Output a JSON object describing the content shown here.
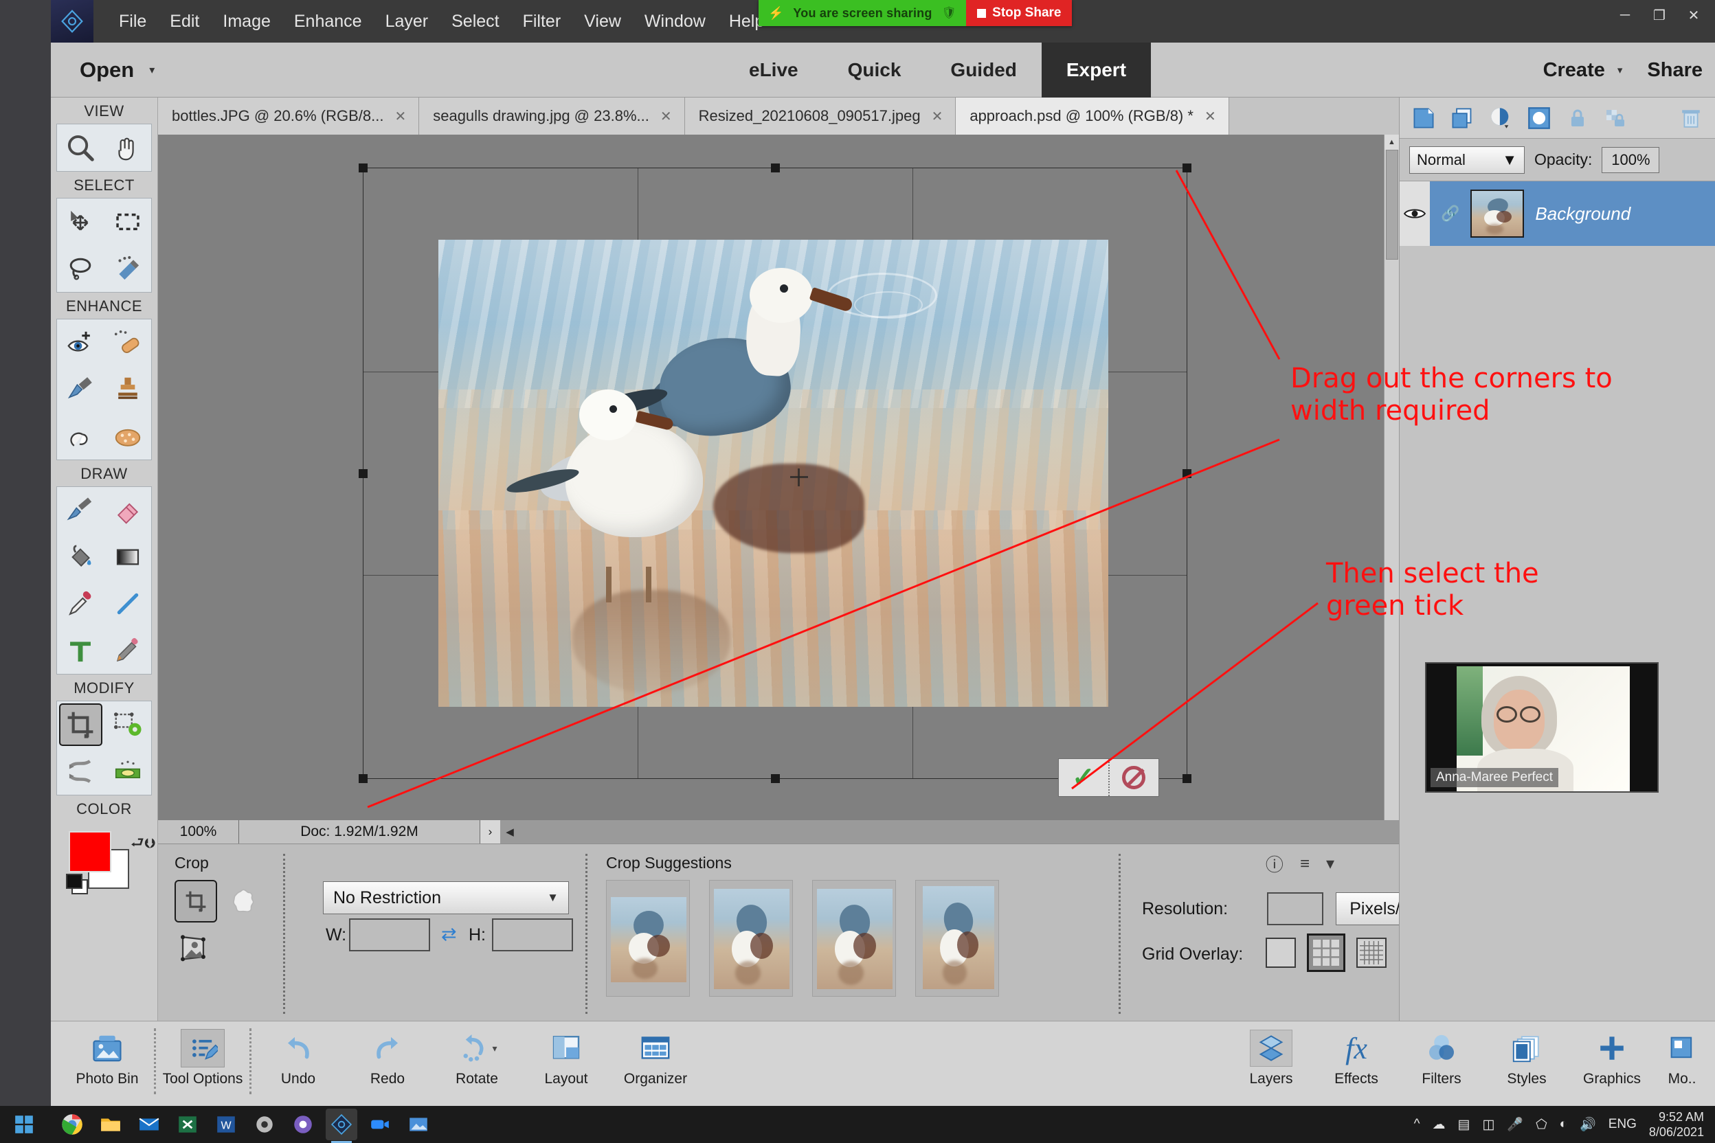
{
  "window": {
    "minimize": "─",
    "restore": "❐",
    "close": "✕"
  },
  "menubar": {
    "logo_icon": "photoshop-elements-logo-icon",
    "items": [
      "File",
      "Edit",
      "Image",
      "Enhance",
      "Layer",
      "Select",
      "Filter",
      "View",
      "Window",
      "Help"
    ]
  },
  "share_banner": {
    "lightning_icon": "lightning-icon",
    "message": "You are screen sharing",
    "shield_icon": "shield-icon",
    "stop_label": "Stop Share"
  },
  "modebar": {
    "open_label": "Open",
    "open_caret": "▾",
    "modes": [
      {
        "label": "eLive",
        "active": false
      },
      {
        "label": "Quick",
        "active": false
      },
      {
        "label": "Guided",
        "active": false
      },
      {
        "label": "Expert",
        "active": true
      }
    ],
    "create_label": "Create",
    "create_caret": "▾",
    "share_label": "Share"
  },
  "toolbar": {
    "groups": [
      {
        "title": "VIEW",
        "tools": [
          "zoom-tool",
          "hand-tool"
        ]
      },
      {
        "title": "SELECT",
        "tools": [
          "move-tool",
          "rectangular-marquee-tool",
          "lasso-tool",
          "quick-selection-tool"
        ]
      },
      {
        "title": "ENHANCE",
        "tools": [
          "red-eye-removal-tool",
          "spot-healing-brush-tool",
          "smart-brush-tool",
          "clone-stamp-tool",
          "blur-tool",
          "sponge-tool"
        ]
      },
      {
        "title": "DRAW",
        "tools": [
          "brush-tool",
          "eraser-tool",
          "paint-bucket-tool",
          "gradient-tool",
          "color-picker-tool",
          "line-tool",
          "type-tool",
          "pencil-tool"
        ]
      },
      {
        "title": "MODIFY",
        "tools": [
          "crop-tool",
          "recompose-tool",
          "content-aware-move-tool",
          "straighten-tool"
        ]
      }
    ],
    "selected_tool": "crop-tool",
    "color": {
      "title": "COLOR",
      "foreground": "#ff0000",
      "background": "#ffffff",
      "swap_icon": "swap-colors-icon",
      "default_icon": "default-colors-icon"
    }
  },
  "tabs": [
    {
      "label": "bottles.JPG @ 20.6% (RGB/8...",
      "active": false,
      "close_icon": "✕"
    },
    {
      "label": "seagulls drawing.jpg @ 23.8%...",
      "active": false,
      "close_icon": "✕"
    },
    {
      "label": "Resized_20210608_090517.jpeg",
      "active": false,
      "close_icon": "✕"
    },
    {
      "label": "approach.psd @ 100% (RGB/8) *",
      "active": true,
      "close_icon": "✕"
    }
  ],
  "canvas": {
    "image_description": "two-seagulls-on-wet-sand-photo",
    "crop_confirm_icon": "green-check-icon",
    "crop_cancel_icon": "cancel-circle-icon",
    "scroll_up_icon": "▲",
    "scroll_down_icon": "▼"
  },
  "annotations": [
    {
      "text": "Drag out the corners to\nwidth required",
      "color": "#ff1010"
    },
    {
      "text": "Then select the\ngreen tick",
      "color": "#ff1010"
    }
  ],
  "statusbar": {
    "zoom": "100%",
    "doc_info": "Doc: 1.92M/1.92M",
    "more_icon": "›",
    "arrow_icon": "◀"
  },
  "tool_options": {
    "crop_title": "Crop",
    "crop_tool_icon": "crop-tool-icon",
    "cookie_cutter_icon": "cookie-cutter-icon",
    "perspective_crop_icon": "perspective-crop-icon",
    "restriction_value": "No Restriction",
    "restriction_caret": "▼",
    "width_label": "W:",
    "width_value": "",
    "height_label": "H:",
    "height_value": "",
    "swap_icon": "swap-dimensions-icon",
    "suggestions_title": "Crop Suggestions",
    "suggestions": [
      "crop-suggestion-1",
      "crop-suggestion-2",
      "crop-suggestion-3",
      "crop-suggestion-4"
    ],
    "resolution_label": "Resolution:",
    "resolution_value": "",
    "resolution_unit": "Pixels/Ce..",
    "grid_overlay_label": "Grid Overlay:",
    "grid_options": [
      {
        "name": "grid-none",
        "selected": false
      },
      {
        "name": "grid-rule-of-thirds",
        "selected": true
      },
      {
        "name": "grid-fine",
        "selected": false
      }
    ],
    "help_icon": "help-icon",
    "menu_icon": "panel-menu-icon",
    "collapse_icon": "collapse-icon"
  },
  "layers_panel": {
    "toolbar_icons": [
      "new-layer-icon",
      "duplicate-layer-icon",
      "adjustment-layer-icon",
      "layer-mask-icon",
      "lock-all-icon",
      "lock-transparency-icon",
      "delete-layer-icon"
    ],
    "blend_mode": "Normal",
    "blend_caret": "▼",
    "opacity_label": "Opacity:",
    "opacity_value": "100%",
    "layers": [
      {
        "name": "Background",
        "visible": true,
        "eye_icon": "eye-icon",
        "link_icon": "link-icon",
        "selected": true
      }
    ]
  },
  "webcam": {
    "participant_name": "Anna-Maree Perfect"
  },
  "bottombar": {
    "left_items": [
      {
        "label": "Photo Bin",
        "icon": "photo-bin-icon",
        "active": false
      },
      {
        "label": "Tool Options",
        "icon": "tool-options-icon",
        "active": true
      },
      {
        "label": "Undo",
        "icon": "undo-icon",
        "active": false
      },
      {
        "label": "Redo",
        "icon": "redo-icon",
        "active": false
      },
      {
        "label": "Rotate",
        "icon": "rotate-icon",
        "active": false
      },
      {
        "label": "Layout",
        "icon": "layout-icon",
        "active": false
      },
      {
        "label": "Organizer",
        "icon": "organizer-icon",
        "active": false
      }
    ],
    "right_items": [
      {
        "label": "Layers",
        "icon": "layers-icon",
        "active": true
      },
      {
        "label": "Effects",
        "icon": "effects-icon",
        "active": false
      },
      {
        "label": "Filters",
        "icon": "filters-icon",
        "active": false
      },
      {
        "label": "Styles",
        "icon": "styles-icon",
        "active": false
      },
      {
        "label": "Graphics",
        "icon": "graphics-icon",
        "active": false
      },
      {
        "label": "Mo..",
        "icon": "more-icon",
        "active": false
      }
    ]
  },
  "taskbar": {
    "start_icon": "windows-start-icon",
    "apps": [
      "chrome-icon",
      "file-explorer-icon",
      "mail-icon",
      "excel-icon",
      "word-icon",
      "settings-icon",
      "photos-icon",
      "photoshop-elements-icon",
      "zoom-icon",
      "photo-viewer-icon"
    ],
    "tray_icons": [
      "show-hidden-icons",
      "onedrive-icon",
      "display-icon",
      "battery-icon",
      "mic-icon",
      "bluetooth-icon",
      "wifi-icon",
      "volume-icon"
    ],
    "language": "ENG",
    "time": "9:52 AM",
    "date": "8/06/2021"
  }
}
